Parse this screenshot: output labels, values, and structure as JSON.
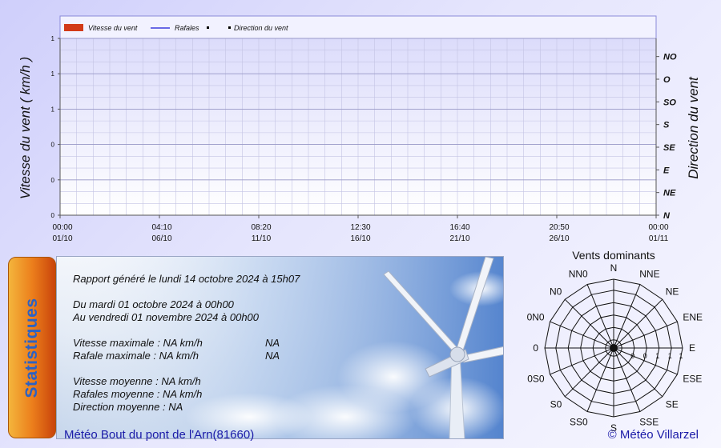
{
  "chart_data": [
    {
      "type": "line",
      "legend": {
        "placement": "top",
        "entries": [
          {
            "label": "Vitesse du vent",
            "color": "#d23a17",
            "kind": "bar"
          },
          {
            "label": "Rafales",
            "color": "#1a1ad8",
            "kind": "line"
          },
          {
            "label": "",
            "color": "#000000",
            "kind": "point"
          },
          {
            "label": "Direction du vent",
            "color": "#000000",
            "kind": "point"
          }
        ]
      },
      "ylabel": "Vitesse du vent ( km/h )",
      "y2label": "Direction du vent",
      "yticks": [
        "1",
        "1",
        "1",
        "0",
        "0",
        "0"
      ],
      "y2ticks": [
        "NO",
        "O",
        "SO",
        "S",
        "SE",
        "E",
        "NE",
        "N"
      ],
      "xticks": [
        {
          "time": "00:00",
          "date": "01/10"
        },
        {
          "time": "04:10",
          "date": "06/10"
        },
        {
          "time": "08:20",
          "date": "11/10"
        },
        {
          "time": "12:30",
          "date": "16/10"
        },
        {
          "time": "16:40",
          "date": "21/10"
        },
        {
          "time": "20:50",
          "date": "26/10"
        },
        {
          "time": "00:00",
          "date": "01/11"
        }
      ],
      "series": [
        {
          "name": "Vitesse du vent",
          "values": []
        },
        {
          "name": "Rafales",
          "values": []
        },
        {
          "name": "Direction du vent",
          "values": []
        }
      ],
      "grid": true
    },
    {
      "type": "radar",
      "title": "Vents dominants",
      "directions": [
        "N",
        "NNE",
        "NE",
        "ENE",
        "E",
        "ESE",
        "SE",
        "SSE",
        "S",
        "SS0",
        "S0",
        "0S0",
        "0",
        "0N0",
        "N0",
        "NN0"
      ],
      "ring_labels": [
        "0",
        "0",
        "1",
        "1",
        "1"
      ],
      "values": []
    }
  ],
  "stats": {
    "tab_label": "Statistiques",
    "report_line": "Rapport généré le lundi 14 octobre 2024 à  15h07",
    "from_line": "Du mardi 01 octobre 2024 à  00h00",
    "to_line": "Au vendredi 01 novembre 2024 à  00h00",
    "max_speed": "Vitesse maximale : NA km/h",
    "max_speed_value": "NA",
    "max_gust": "Rafale maximale : NA km/h",
    "max_gust_value": "NA",
    "avg_speed": "Vitesse moyenne : NA km/h",
    "avg_gust": "Rafales moyenne : NA km/h",
    "avg_direction": "Direction moyenne : NA"
  },
  "footer": {
    "station": "Météo Bout du pont de l'Arn(81660)",
    "copyright": "© Météo Villarzel"
  }
}
